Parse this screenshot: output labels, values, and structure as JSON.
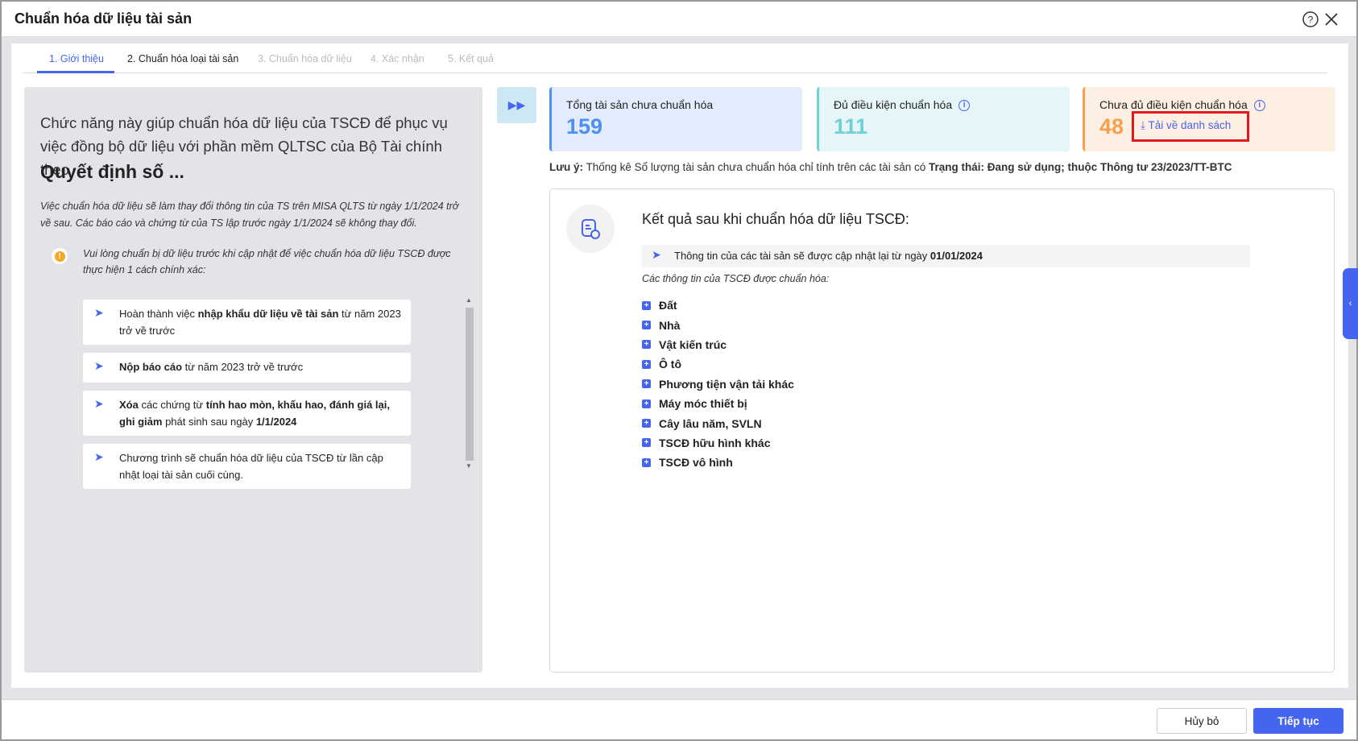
{
  "window": {
    "title": "Chuẩn hóa dữ liệu tài sản"
  },
  "tabs": [
    {
      "label": "1. Giới thiệu",
      "state": "active"
    },
    {
      "label": "2. Chuẩn hóa loại tài sản",
      "state": "done"
    },
    {
      "label": "3. Chuẩn hóa dữ liệu",
      "state": "disabled"
    },
    {
      "label": "4. Xác nhận",
      "state": "disabled"
    },
    {
      "label": "5. Kết quả",
      "state": "disabled"
    }
  ],
  "intro": {
    "lead": "Chức năng này giúp chuẩn hóa dữ liệu của TSCĐ để phục vụ việc đồng bộ dữ liệu với phần mềm QLTSC của Bộ Tài chính theo",
    "decision": "Quyết định số ...",
    "note": "Việc chuẩn hóa dữ liệu sẽ làm thay đổi thông tin của TS trên MISA QLTS từ ngày 1/1/2024 trở về sau. Các báo cáo và chứng từ của TS lập trước ngày 1/1/2024 sẽ không thay đổi.",
    "warning": "Vui lòng chuẩn bị dữ liệu trước khi cập nhật để việc chuẩn hóa dữ liệu TSCĐ được thực hiện 1 cách chính xác:",
    "steps": [
      {
        "a": "Hoàn thành việc ",
        "b": "nhập khẩu dữ liệu về tài sản",
        "c": " từ năm 2023 trở về trước"
      },
      {
        "a": "",
        "b": "Nộp báo cáo",
        "c": " từ năm 2023 trở về trước"
      },
      {
        "a": "",
        "b": "Xóa",
        "c": " các chứng từ ",
        "d": "tính hao mòn, khấu hao, đánh giá lại, ghi giảm",
        "e": " phát sinh sau ngày ",
        "f": "1/1/2024"
      },
      {
        "a": "Chương trình sẽ chuẩn hóa dữ liệu của TSCĐ từ lần cập nhật loại tài sản cuối cùng.",
        "b": "",
        "c": ""
      }
    ]
  },
  "stats": [
    {
      "label": "Tổng tài sản chưa chuẩn hóa",
      "value": "159",
      "color": "#4f8ef5",
      "bg": "#e3ecfc"
    },
    {
      "label": "Đủ điều kiện chuẩn hóa",
      "value": "111",
      "color": "#6fd0d6",
      "bg": "#e6f6f8"
    },
    {
      "label": "Chưa đủ điều kiện chuẩn hóa",
      "value": "48",
      "color": "#f6a04d",
      "bg": "#fdefe2",
      "download": "Tải về danh sách"
    }
  ],
  "note": {
    "prefix": "Lưu ý:",
    "text": " Thống kê Số lượng tài sản chưa chuẩn hóa chỉ tính trên các tài sản có ",
    "bold": "Trạng thái: Đang sử dụng; thuộc Thông tư 23/2023/TT-BTC"
  },
  "result": {
    "heading": "Kết quả sau khi chuẩn hóa dữ liệu TSCĐ:",
    "update_text": "Thông tin của các tài sản sẽ được cập nhật lại từ ngày ",
    "update_date": "01/01/2024",
    "subtitle": "Các thông tin của TSCĐ được chuẩn hóa:",
    "items": [
      "Đất",
      "Nhà",
      "Vật kiến trúc",
      "Ô tô",
      "Phương tiện vận tải khác",
      "Máy móc thiết bị",
      "Cây lâu năm, SVLN",
      "TSCĐ hữu hình khác",
      "TSCĐ vô hình"
    ]
  },
  "footer": {
    "cancel": "Hủy bỏ",
    "next": "Tiếp tục"
  },
  "accent": "#4565f0"
}
